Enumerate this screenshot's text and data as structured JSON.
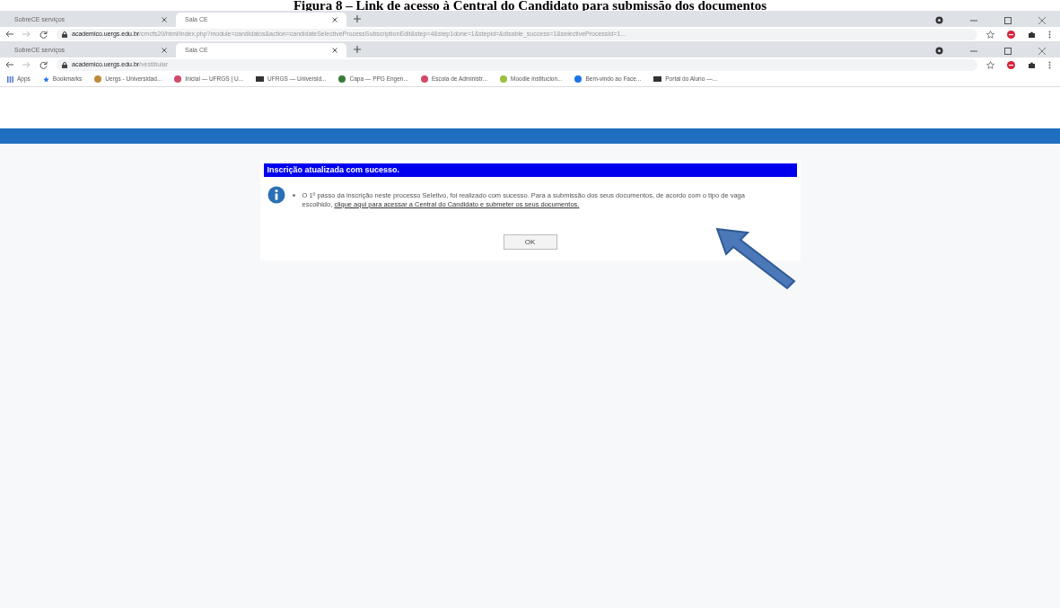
{
  "caption": "Figura 8 – Link de acesso à Central do Candidato para submissão dos documentos",
  "back_window": {
    "tabs": [
      {
        "label": "SobreCE serviços",
        "selected": false
      },
      {
        "label": "Sala CE",
        "selected": true
      }
    ],
    "url_host": "academico.uergs.edu.br",
    "url_path": "/cmcfs20/html/index.php?module=candidatos&action=candidateSelectiveProcessSubscriptionEdit&step=4&step1done=1&stepid=&disable_success=1&selectiveProcessId=1..."
  },
  "front_window": {
    "tabs": [
      {
        "label": "SobreCE serviços",
        "selected": false
      },
      {
        "label": "Sala CE",
        "selected": true
      }
    ],
    "url_host": "academico.uergs.edu.br",
    "url_path": "/vestibular",
    "bookmarks": [
      {
        "label": "Apps",
        "kind": "apps"
      },
      {
        "label": "Bookmarks",
        "kind": "star",
        "color": "#1a73e8"
      },
      {
        "label": "Uergs - Universidad...",
        "kind": "dot",
        "color": "#c08a3a"
      },
      {
        "label": "Inicial — UFRGS | U...",
        "kind": "dot",
        "color": "#d04a6a"
      },
      {
        "label": "UFRGS — Universid...",
        "kind": "text",
        "color": "#333333"
      },
      {
        "label": "Capa — PPG Engen...",
        "kind": "dot",
        "color": "#3a7a3a"
      },
      {
        "label": "Escola de Administr...",
        "kind": "dot",
        "color": "#d04a6a"
      },
      {
        "label": "Moodle institucion...",
        "kind": "dot",
        "color": "#9ac040"
      },
      {
        "label": "Bem-vindo ao Face...",
        "kind": "dot",
        "color": "#1a73e8"
      },
      {
        "label": "Portal do Aluno —...",
        "kind": "text",
        "color": "#333333"
      }
    ]
  },
  "dialog": {
    "title": "Inscrição atualizada com sucesso.",
    "message": "O 1º passo da inscrição neste processo Seletivo, foi realizado com sucesso. Para a submissão dos seus documentos, de acordo com o tipo de vaga escolhido,",
    "link": "clique aqui para acessar a Central do Candidato e submeter os seus documentos.",
    "button": "OK"
  }
}
